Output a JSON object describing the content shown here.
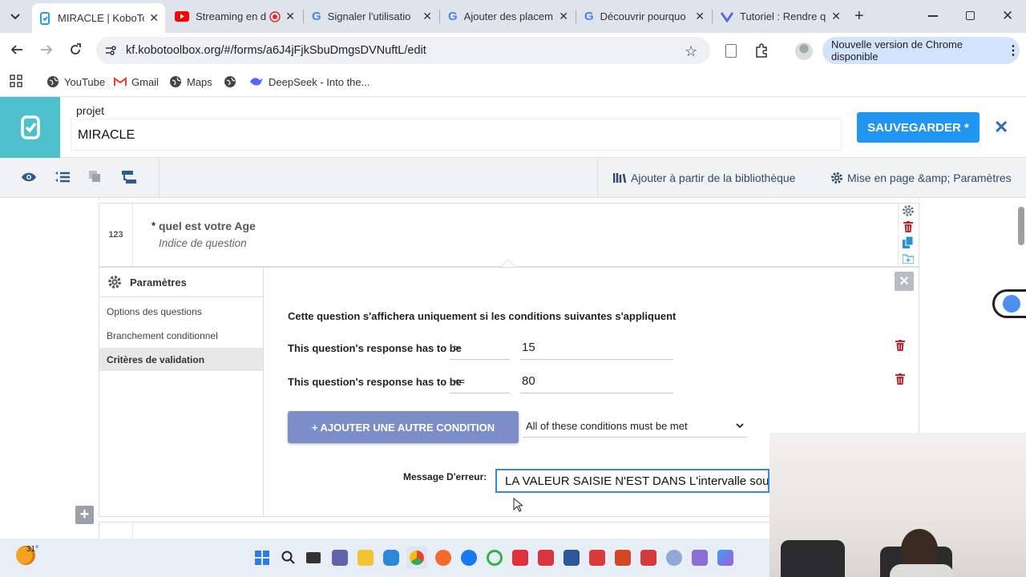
{
  "browser": {
    "tabs": [
      {
        "label": "MIRACLE | KoboTo",
        "active": true
      },
      {
        "label": "Streaming en d",
        "active": false
      },
      {
        "label": "Signaler l'utilisatio",
        "active": false
      },
      {
        "label": "Ajouter des placem",
        "active": false
      },
      {
        "label": "Découvrir pourquo",
        "active": false
      },
      {
        "label": "Tutoriel : Rendre q",
        "active": false
      }
    ],
    "url": "kf.kobotoolbox.org/#/forms/a6J4jFjkSbuDmgsDVNuftL/edit",
    "update_label": "Nouvelle version de Chrome disponible",
    "bookmarks": [
      "YouTube",
      "Gmail",
      "Maps",
      "DeepSeek - Into the..."
    ]
  },
  "kobo": {
    "project_label": "projet",
    "project_name": "MIRACLE",
    "save_label": "SAUVEGARDER *",
    "library_label": "Ajouter à partir de la bibliothèque",
    "layout_label": "Mise en page &amp; Paramètres",
    "accent": "#2095f2",
    "logo_bg": "#4dc0cc"
  },
  "question": {
    "number": "123",
    "required_mark": "*",
    "label": "quel est votre Age",
    "hint": "Indice de question"
  },
  "settings": {
    "title": "Paramètres",
    "nav": [
      "Options des questions",
      "Branchement conditionnel",
      "Critères de validation"
    ],
    "active_nav": 2,
    "heading": "Cette question s'affichera uniquement si les conditions suivantes s'appliquent",
    "conditions": [
      {
        "label": "This question's response has to be",
        "operator": ">",
        "value": "15"
      },
      {
        "label": "This question's response has to be",
        "operator": "<=",
        "value": "80"
      }
    ],
    "add_condition_label": "+ AJOUTER UNE AUTRE CONDITION",
    "match_select": "All of these conditions must be met",
    "error_label": "Message D'erreur:",
    "error_value": "LA VALEUR SAISIE N'EST DANS L'intervalle souhaité"
  },
  "taskbar": {
    "weather_temp": "31°"
  }
}
